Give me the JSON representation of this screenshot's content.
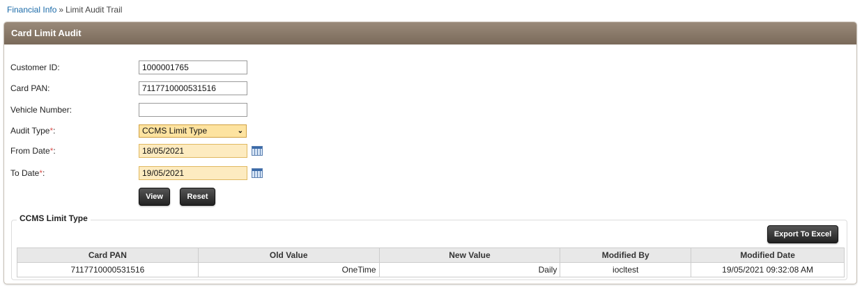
{
  "breadcrumb": {
    "link": "Financial Info",
    "separator": "»",
    "current": "Limit Audit Trail"
  },
  "panel": {
    "title": "Card Limit Audit"
  },
  "form": {
    "customer_id": {
      "label": "Customer ID:",
      "value": "1000001765"
    },
    "card_pan": {
      "label": "Card PAN:",
      "value": "7117710000531516"
    },
    "vehicle_number": {
      "label": "Vehicle Number:",
      "value": ""
    },
    "audit_type": {
      "label": "Audit Type",
      "required": "*",
      "colon": ":",
      "value": "CCMS Limit Type"
    },
    "from_date": {
      "label": "From Date",
      "required": "*",
      "colon": ":",
      "value": "18/05/2021"
    },
    "to_date": {
      "label": "To Date",
      "required": "*",
      "colon": ":",
      "value": "19/05/2021"
    },
    "view_label": "View",
    "reset_label": "Reset"
  },
  "results": {
    "legend": "CCMS Limit Type",
    "export_label": "Export To Excel",
    "columns": [
      "Card PAN",
      "Old Value",
      "New Value",
      "Modified By",
      "Modified Date"
    ],
    "rows": [
      [
        "7117710000531516",
        "OneTime",
        "Daily",
        "iocltest",
        "19/05/2021 09:32:08 AM"
      ]
    ]
  },
  "colors": {
    "header": "#8a7a6a",
    "link": "#1a6aa8",
    "required": "#d9534f",
    "highlight_field": "#fdebc0"
  }
}
